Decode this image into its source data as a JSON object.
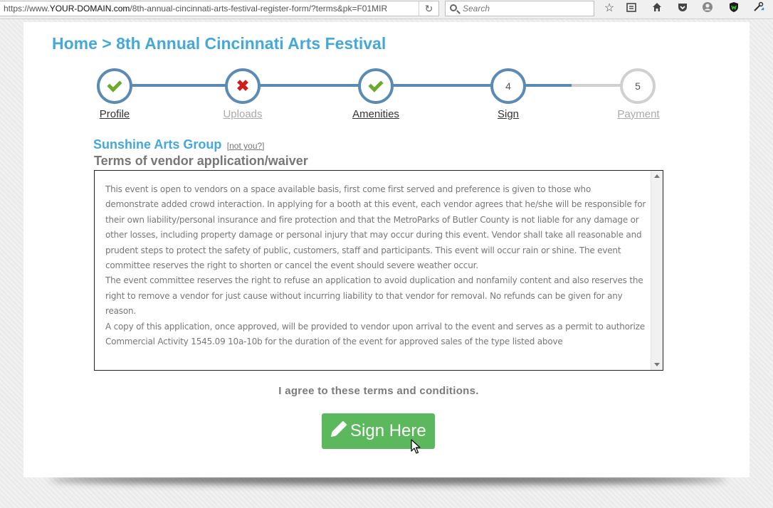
{
  "browser": {
    "url_prefix": "https://www.",
    "url_domain": "YOUR-DOMAIN.com",
    "url_path": "/8th-annual-cincinnati-arts-festival-register-form/?terms&pk=F01MIR",
    "search_placeholder": "Search"
  },
  "page": {
    "title": "Home > 8th Annual Cincinnati Arts Festival"
  },
  "steps": [
    {
      "number": "",
      "label": "Profile",
      "status": "complete"
    },
    {
      "number": "",
      "label": "Uploads",
      "status": "error"
    },
    {
      "number": "",
      "label": "Amenities",
      "status": "complete"
    },
    {
      "number": "4",
      "label": "Sign",
      "status": "current"
    },
    {
      "number": "5",
      "label": "Payment",
      "status": "pending"
    }
  ],
  "vendor": {
    "name": "Sunshine Arts Group",
    "not_you": "[not you?]"
  },
  "terms": {
    "heading": "Terms of vendor application/waiver",
    "paragraphs": [
      "This event is open to vendors on a space available basis, first come first served and preference is given to those who demonstrate added crowd interaction. In applying for a booth at this event, each vendor agrees that he/she will be responsible for their own liability/personal insurance and fire protection and that the MetroParks of Butler County is not liable for any damage or other losses, including property damage or personal injury that may occur during this event. Vendor shall take all reasonable and prudent steps to protect the safety of public, customers, staff and participants. This event will occur rain or shine. The event committee reserves the right to shorten or cancel the event should severe weather occur.",
      "The event committee reserves the right to refuse an application to avoid duplication and nonfamily content and also reserves the right to remove a vendor for just cause without incurring liability to that vendor for removal. No refunds can be given for any reason.",
      "A copy of this application, once approved, will be provided to vendor upon arrival to the event and serves as a permit to authorize Commercial Activity 1545.09 10a-10b for the duration of the event for approved sales of the type listed above"
    ]
  },
  "agree_text": "I agree to these terms and conditions.",
  "sign_button": {
    "label": "Sign Here",
    "icon": "pencil-icon"
  },
  "colors": {
    "accent": "#44a9d9",
    "step_done": "#5b8ab5",
    "step_pending": "#d0d0d0",
    "check": "#6aab2c",
    "cross": "#cc1f1f",
    "button": "#5cb85c"
  }
}
